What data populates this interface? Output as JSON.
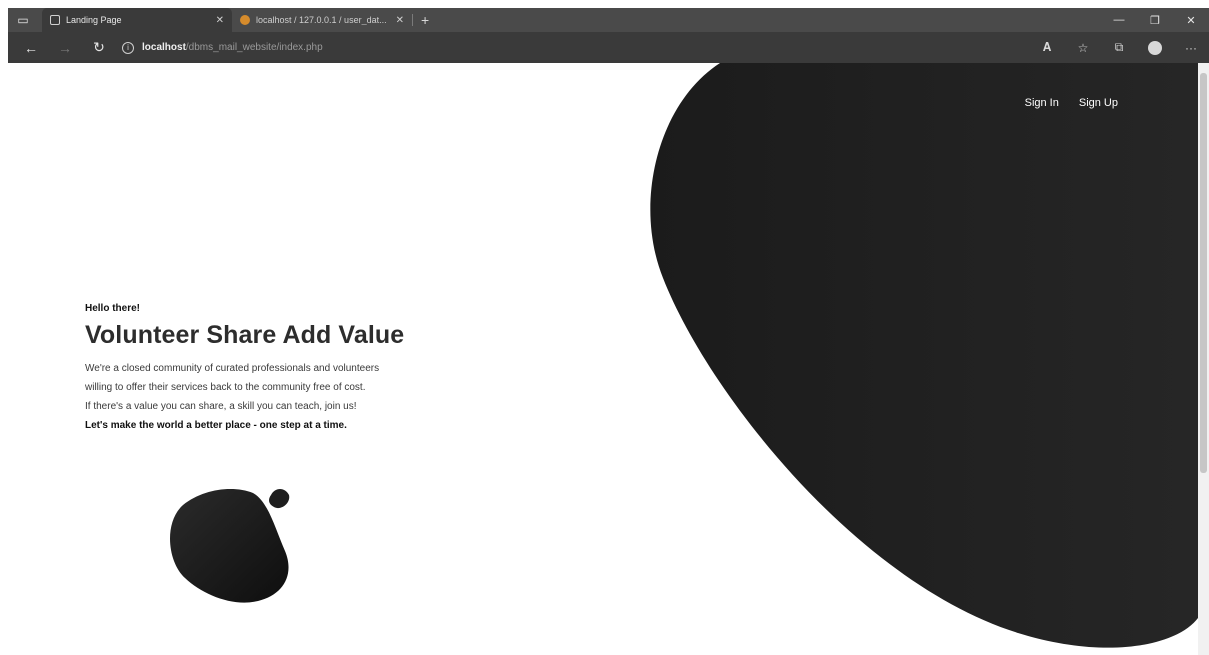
{
  "browser": {
    "tabs": [
      {
        "title": "Landing Page",
        "active": true
      },
      {
        "title": "localhost / 127.0.0.1 / user_dat...",
        "active": false
      }
    ],
    "url_host": "localhost",
    "url_path": "/dbms_mail_website/index.php"
  },
  "nav": {
    "sign_in": "Sign In",
    "sign_up": "Sign Up"
  },
  "hero": {
    "greeting": "Hello there!",
    "title": "Volunteer Share Add Value",
    "line1": "We're a closed community of curated professionals and volunteers",
    "line2": "willing to offer their services back to the community free of cost.",
    "line3": "If there's a value you can share, a skill you can teach, join us!",
    "tagline": "Let's make the world a better place - one step at a time."
  },
  "colors": {
    "blob_dark": "#222222",
    "chrome_dark": "#3a3a3a",
    "text_dark": "#2d2d2d"
  }
}
